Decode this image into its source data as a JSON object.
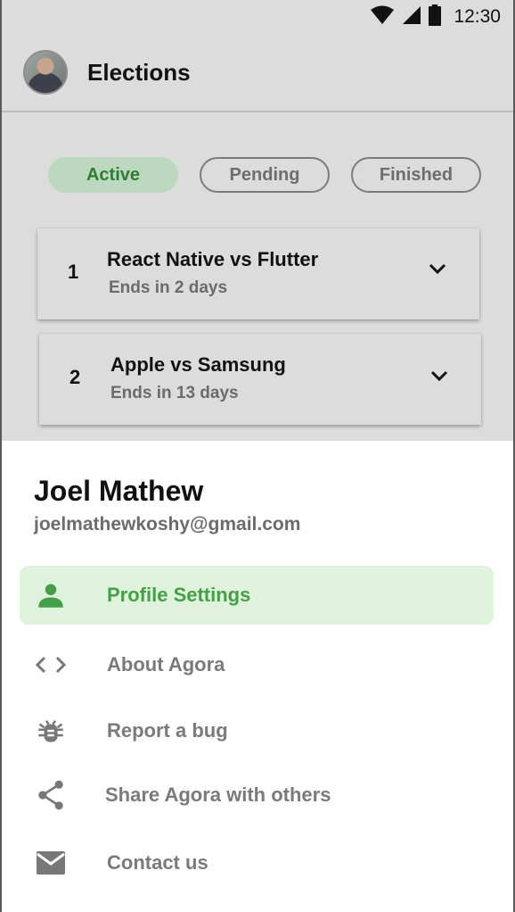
{
  "status_bar": {
    "time": "12:30",
    "icons": [
      "wifi-icon",
      "signal-icon",
      "battery-icon"
    ]
  },
  "app_bar": {
    "title": "Elections"
  },
  "tabs": [
    {
      "label": "Active",
      "selected": true
    },
    {
      "label": "Pending",
      "selected": false
    },
    {
      "label": "Finished",
      "selected": false
    }
  ],
  "elections": [
    {
      "number": "1",
      "name": "React Native vs Flutter",
      "ends": "Ends in 2 days"
    },
    {
      "number": "2",
      "name": "Apple vs Samsung",
      "ends": "Ends in 13 days"
    }
  ],
  "drawer": {
    "user_name": "Joel Mathew",
    "email": "joelmathewkoshy@gmail.com",
    "items": [
      {
        "label": "Profile Settings",
        "icon": "person-icon",
        "selected": true
      },
      {
        "label": "About Agora",
        "icon": "code-icon",
        "selected": false
      },
      {
        "label": "Report a bug",
        "icon": "bug-icon",
        "selected": false
      },
      {
        "label": "Share Agora with others",
        "icon": "share-icon",
        "selected": false
      },
      {
        "label": "Contact us",
        "icon": "mail-icon",
        "selected": false
      }
    ]
  },
  "colors": {
    "accent": "#43a047",
    "accent_bg": "#dff3dc",
    "scrim": "#dcdcdc"
  }
}
